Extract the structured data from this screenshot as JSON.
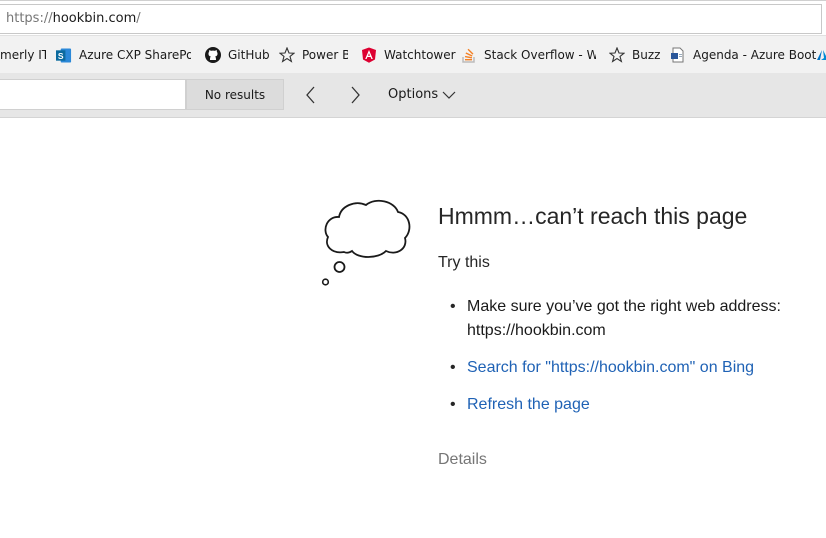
{
  "address_bar": {
    "url_prefix": "https://",
    "url_host": "hookbin.com",
    "url_suffix": "/"
  },
  "favorites": [
    {
      "icon": "truncated",
      "label": "merly ITV"
    },
    {
      "icon": "sharepoint-icon",
      "label": "Azure CXP SharePoin"
    },
    {
      "icon": "github-icon",
      "label": "GitHub"
    },
    {
      "icon": "star-icon",
      "label": "Power BI"
    },
    {
      "icon": "angular-icon",
      "label": "Watchtower"
    },
    {
      "icon": "stackoverflow-icon",
      "label": "Stack Overflow - Whe"
    },
    {
      "icon": "star-icon",
      "label": "Buzz"
    },
    {
      "icon": "document-icon",
      "label": "Agenda - Azure Boot"
    }
  ],
  "find_bar": {
    "query": "",
    "results_label": "No results",
    "options_label": "Options"
  },
  "error": {
    "title": "Hmmm…can’t reach this page",
    "try_this": "Try this",
    "tip_1": "Make sure you’ve got the right web address: https://hookbin.com",
    "tip_2_link": "Search for \"https://hookbin.com\" on Bing",
    "tip_3_link": "Refresh the page",
    "details_label": "Details"
  },
  "colors": {
    "link": "#1f62b5",
    "toolbar": "#f2f2f2",
    "findbar": "#e6e6e6"
  }
}
